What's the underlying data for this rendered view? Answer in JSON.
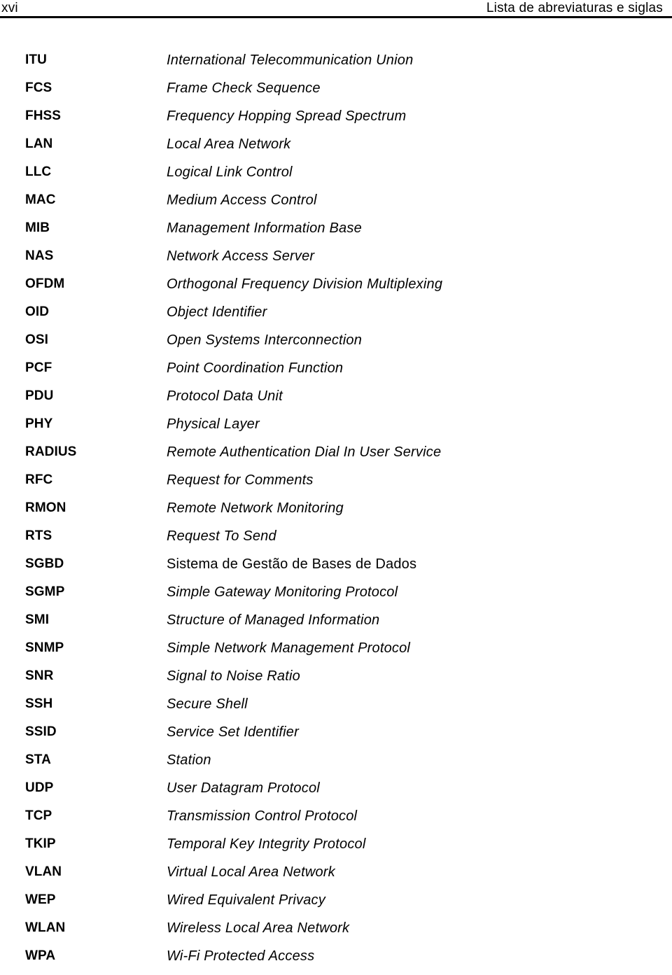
{
  "header": {
    "folio": "xvi",
    "title": "Lista de abreviaturas e siglas"
  },
  "list": {
    "entries": [
      {
        "term": "ITU",
        "definition": "International Telecommunication Union",
        "style": "italic"
      },
      {
        "term": "FCS",
        "definition": "Frame Check Sequence",
        "style": "italic"
      },
      {
        "term": "FHSS",
        "definition": "Frequency Hopping Spread Spectrum",
        "style": "italic"
      },
      {
        "term": "LAN",
        "definition": "Local Area Network",
        "style": "italic"
      },
      {
        "term": "LLC",
        "definition": "Logical Link Control",
        "style": "italic"
      },
      {
        "term": "MAC",
        "definition": "Medium Access Control",
        "style": "italic"
      },
      {
        "term": "MIB",
        "definition": "Management Information Base",
        "style": "italic"
      },
      {
        "term": "NAS",
        "definition": "Network Access Server",
        "style": "italic"
      },
      {
        "term": "OFDM",
        "definition": "Orthogonal Frequency Division Multiplexing",
        "style": "italic"
      },
      {
        "term": "OID",
        "definition": "Object Identifier",
        "style": "italic"
      },
      {
        "term": "OSI",
        "definition": "Open Systems Interconnection",
        "style": "italic"
      },
      {
        "term": "PCF",
        "definition": "Point Coordination Function",
        "style": "italic"
      },
      {
        "term": "PDU",
        "definition": "Protocol Data Unit",
        "style": "italic"
      },
      {
        "term": "PHY",
        "definition": "Physical Layer",
        "style": "italic"
      },
      {
        "term": "RADIUS",
        "definition": "Remote Authentication Dial In User Service",
        "style": "italic"
      },
      {
        "term": "RFC",
        "definition": "Request for Comments",
        "style": "italic"
      },
      {
        "term": "RMON",
        "definition": "Remote Network Monitoring",
        "style": "italic"
      },
      {
        "term": "RTS",
        "definition": "Request To Send",
        "style": "italic"
      },
      {
        "term": "SGBD",
        "definition": "Sistema de Gestão de Bases de Dados",
        "style": "roman"
      },
      {
        "term": "SGMP",
        "definition": "Simple Gateway Monitoring Protocol",
        "style": "italic"
      },
      {
        "term": "SMI",
        "definition": "Structure of Managed Information",
        "style": "italic"
      },
      {
        "term": "SNMP",
        "definition": "Simple Network Management Protocol",
        "style": "italic"
      },
      {
        "term": "SNR",
        "definition": "Signal to Noise Ratio",
        "style": "italic"
      },
      {
        "term": "SSH",
        "definition": "Secure Shell",
        "style": "italic"
      },
      {
        "term": "SSID",
        "definition": "Service Set Identifier",
        "style": "italic"
      },
      {
        "term": "STA",
        "definition": "Station",
        "style": "italic"
      },
      {
        "term": "UDP",
        "definition": "User Datagram Protocol",
        "style": "italic"
      },
      {
        "term": "TCP",
        "definition": "Transmission Control Protocol",
        "style": "italic"
      },
      {
        "term": "TKIP",
        "definition": "Temporal Key Integrity Protocol",
        "style": "italic"
      },
      {
        "term": "VLAN",
        "definition": "Virtual Local Area Network",
        "style": "italic"
      },
      {
        "term": "WEP",
        "definition": "Wired Equivalent Privacy",
        "style": "italic"
      },
      {
        "term": "WLAN",
        "definition": "Wireless Local Area Network",
        "style": "italic"
      },
      {
        "term": "WPA",
        "definition": "Wi-Fi Protected Access",
        "style": "italic"
      }
    ]
  }
}
